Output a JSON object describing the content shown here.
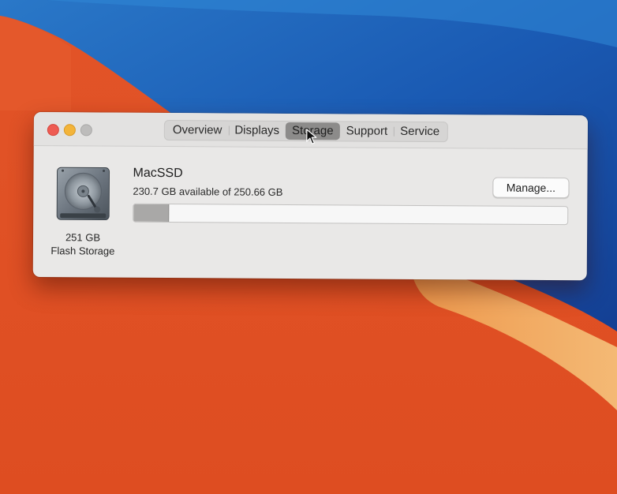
{
  "window": {
    "tabs": [
      {
        "label": "Overview",
        "selected": false
      },
      {
        "label": "Displays",
        "selected": false
      },
      {
        "label": "Storage",
        "selected": true
      },
      {
        "label": "Support",
        "selected": false
      },
      {
        "label": "Service",
        "selected": false
      }
    ]
  },
  "disk": {
    "capacity_label": "251 GB",
    "type_label": "Flash Storage",
    "icon": "hard-drive-icon"
  },
  "volume": {
    "name": "MacSSD",
    "available_text": "230.7 GB available of 250.66 GB",
    "used_fraction": 0.08
  },
  "manage_button": {
    "label": "Manage..."
  },
  "colors": {
    "close": "#ee5b52",
    "minimize": "#f3b43a",
    "zoom": "#bdbcbb",
    "selected_tab": "#8c8b8a",
    "used_bar": "#a9a8a7"
  }
}
